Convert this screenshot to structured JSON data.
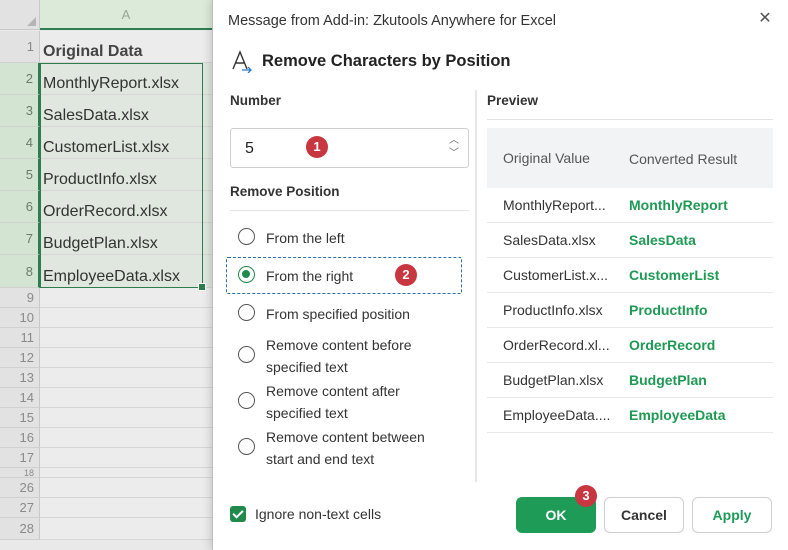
{
  "spreadsheet": {
    "column_header": "A",
    "rows": [
      {
        "num": "1",
        "value": "Original Data"
      },
      {
        "num": "2",
        "value": "MonthlyReport.xlsx"
      },
      {
        "num": "3",
        "value": "SalesData.xlsx"
      },
      {
        "num": "4",
        "value": "CustomerList.xlsx"
      },
      {
        "num": "5",
        "value": "ProductInfo.xlsx"
      },
      {
        "num": "6",
        "value": "OrderRecord.xlsx"
      },
      {
        "num": "7",
        "value": "BudgetPlan.xlsx"
      },
      {
        "num": "8",
        "value": "EmployeeData.xlsx"
      },
      {
        "num": "9",
        "value": ""
      },
      {
        "num": "10",
        "value": ""
      },
      {
        "num": "11",
        "value": ""
      },
      {
        "num": "12",
        "value": ""
      },
      {
        "num": "13",
        "value": ""
      },
      {
        "num": "14",
        "value": ""
      },
      {
        "num": "15",
        "value": ""
      },
      {
        "num": "16",
        "value": ""
      },
      {
        "num": "17",
        "value": ""
      },
      {
        "num": "18",
        "value": ""
      },
      {
        "num": "26",
        "value": ""
      },
      {
        "num": "27",
        "value": ""
      },
      {
        "num": "28",
        "value": ""
      }
    ]
  },
  "dialog": {
    "window_title": "Message from Add-in: Zkutools Anywhere for Excel",
    "heading": "Remove Characters by Position",
    "number_label": "Number",
    "number_value": "5",
    "remove_position_label": "Remove Position",
    "options": [
      {
        "label": "From the left",
        "checked": false
      },
      {
        "label": "From the right",
        "checked": true
      },
      {
        "label": "From specified position",
        "checked": false
      },
      {
        "label": "Remove content before specified text",
        "checked": false
      },
      {
        "label": "Remove content after specified text",
        "checked": false
      },
      {
        "label": "Remove content between start and end text",
        "checked": false
      }
    ],
    "preview_label": "Preview",
    "preview_headers": {
      "original": "Original Value",
      "converted": "Converted Result"
    },
    "preview_rows": [
      {
        "original": "MonthlyReport...",
        "converted": "MonthlyReport"
      },
      {
        "original": "SalesData.xlsx",
        "converted": "SalesData"
      },
      {
        "original": "CustomerList.x...",
        "converted": "CustomerList"
      },
      {
        "original": "ProductInfo.xlsx",
        "converted": "ProductInfo"
      },
      {
        "original": "OrderRecord.xl...",
        "converted": "OrderRecord"
      },
      {
        "original": "BudgetPlan.xlsx",
        "converted": "BudgetPlan"
      },
      {
        "original": "EmployeeData....",
        "converted": "EmployeeData"
      }
    ],
    "ignore_non_text_label": "Ignore non-text cells",
    "ignore_non_text_checked": true,
    "ok_label": "OK",
    "cancel_label": "Cancel",
    "apply_label": "Apply",
    "badges": [
      "1",
      "2",
      "3"
    ]
  },
  "colors": {
    "accent": "#1e9b57",
    "badge": "#c8363f",
    "highlight_border": "#2b6ea8",
    "selection": "#2e7d4f"
  },
  "icons": {
    "close": "close-icon",
    "heading": "text-remove-icon",
    "spinner": "chevron-up-down-icon"
  }
}
